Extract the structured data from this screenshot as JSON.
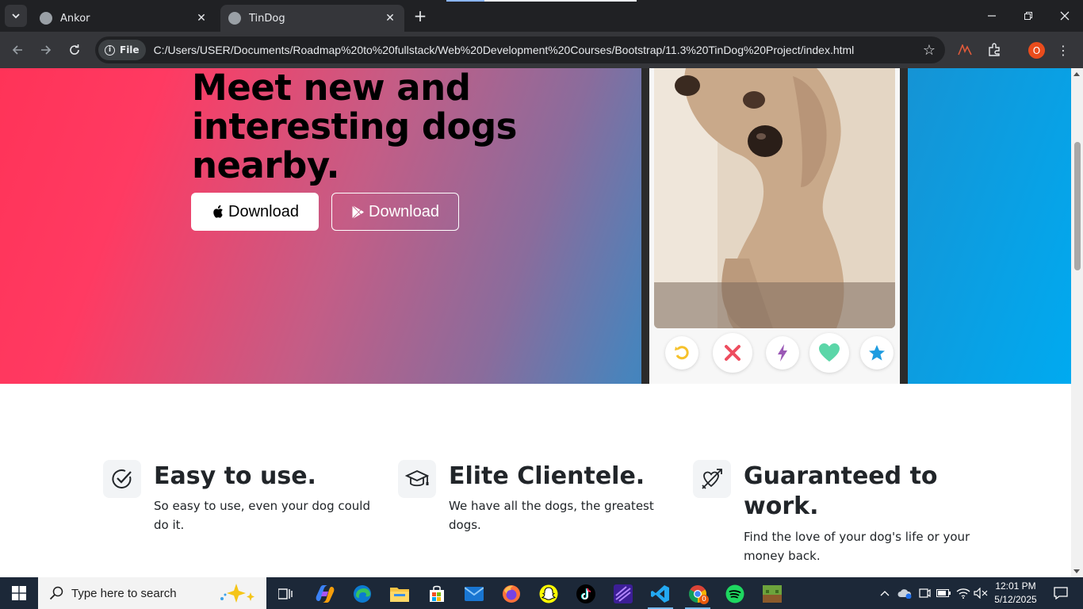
{
  "browser": {
    "tabs": [
      {
        "title": "Ankor",
        "active": false
      },
      {
        "title": "TinDog",
        "active": true
      }
    ],
    "new_tab_label": "+",
    "file_chip": "File",
    "url": "C:/Users/USER/Documents/Roadmap%20to%20fullstack/Web%20Development%20Courses/Bootstrap/11.3%20TinDog%20Project/index.html",
    "profile_initial": "O"
  },
  "hero": {
    "title": "Meet new and interesting dogs nearby.",
    "buttons": [
      {
        "label": "Download",
        "icon": "apple-icon",
        "style": "light"
      },
      {
        "label": "Download",
        "icon": "google-play-icon",
        "style": "outline"
      }
    ]
  },
  "phone": {
    "actions": [
      "rewind-icon",
      "nope-icon",
      "boost-icon",
      "like-icon",
      "super-like-icon"
    ]
  },
  "features": [
    {
      "icon": "check-circle-icon",
      "title": "Easy to use.",
      "text": "So easy to use, even your dog could do it."
    },
    {
      "icon": "graduation-cap-icon",
      "title": "Elite Clientele.",
      "text": "We have all the dogs, the greatest dogs."
    },
    {
      "icon": "heart-arrow-icon",
      "title": "Guaranteed to work.",
      "text": "Find the love of your dog's life or your money back."
    }
  ],
  "taskbar": {
    "search_placeholder": "Type here to search",
    "time": "12:01 PM",
    "date": "5/12/2025",
    "chrome_badge": "0"
  },
  "colors": {
    "hero_gradient_start": "#ff3358",
    "hero_gradient_end": "#00aaf0",
    "taskbar": "#1c2838",
    "browser_dark": "#202124"
  }
}
